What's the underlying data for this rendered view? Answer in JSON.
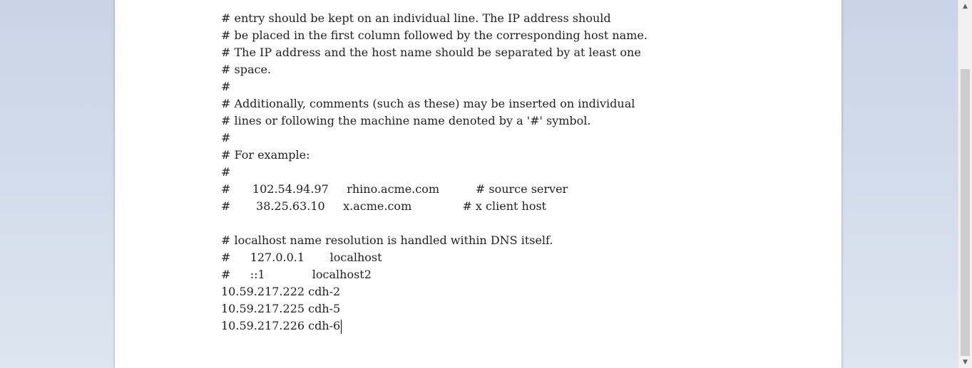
{
  "editor": {
    "lines": [
      "# entry should be kept on an individual line. The IP address should",
      "# be placed in the first column followed by the corresponding host name.",
      "# The IP address and the host name should be separated by at least one",
      "# space.",
      "#",
      "# Additionally, comments (such as these) may be inserted on individual",
      "# lines or following the machine name denoted by a '#' symbol.",
      "#",
      "# For example:",
      "#",
      "#      102.54.94.97     rhino.acme.com          # source server",
      "#       38.25.63.10     x.acme.com              # x client host",
      "",
      "# localhost name resolution is handled within DNS itself.",
      "#\t127.0.0.1       localhost",
      "#\t::1             localhost2",
      "10.59.217.222 cdh-2",
      "10.59.217.225 cdh-5",
      "10.59.217.226 cdh-6"
    ]
  },
  "scrollbar": {
    "up_icon": "arrow-up-icon",
    "down_icon": "arrow-down-icon",
    "up_glyph": "▲",
    "down_glyph": "▼"
  }
}
